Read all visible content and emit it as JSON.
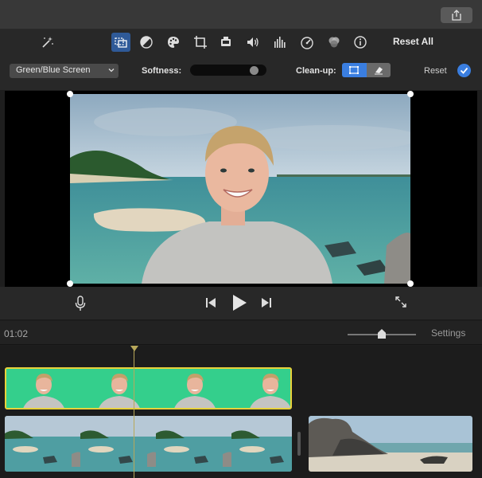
{
  "toolbar": {
    "reset_all_label": "Reset All",
    "tools": [
      "magic-wand",
      "video-overlay",
      "color-balance",
      "color-correction",
      "crop",
      "stabilization",
      "volume",
      "equalizer",
      "speed",
      "clip-filter",
      "info"
    ],
    "active_tool": "video-overlay"
  },
  "options": {
    "overlay_mode": "Green/Blue Screen",
    "softness_label": "Softness:",
    "softness_value": 0.9,
    "cleanup_label": "Clean-up:",
    "reset_label": "Reset"
  },
  "timeline": {
    "timecode": "01:02",
    "settings_label": "Settings",
    "zoom_value": 0.5
  },
  "colors": {
    "accent": "#3a7ee0",
    "clip_selected_border": "#e8d23a",
    "green_screen": "#2fd08a"
  }
}
